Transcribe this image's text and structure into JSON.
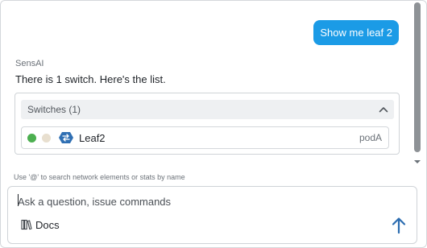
{
  "chat": {
    "user_message": "Show me leaf 2",
    "assistant": {
      "sender": "SensAI",
      "text": "There is 1 switch. Here's the list."
    },
    "switches_card": {
      "title": "Switches (1)",
      "rows": [
        {
          "name": "Leaf2",
          "pod": "podA",
          "status_colors": [
            "#4caf50",
            "#e8dfcf"
          ],
          "icon": "switch-icon"
        }
      ]
    }
  },
  "composer": {
    "hint": "Use '@' to search network elements or stats by name",
    "placeholder": "Ask a question, issue commands",
    "docs_label": "Docs",
    "docs_icon": "books-icon",
    "send_icon": "arrow-up-icon"
  },
  "colors": {
    "accent": "#1b9be6",
    "send_arrow": "#2b6cb0"
  }
}
